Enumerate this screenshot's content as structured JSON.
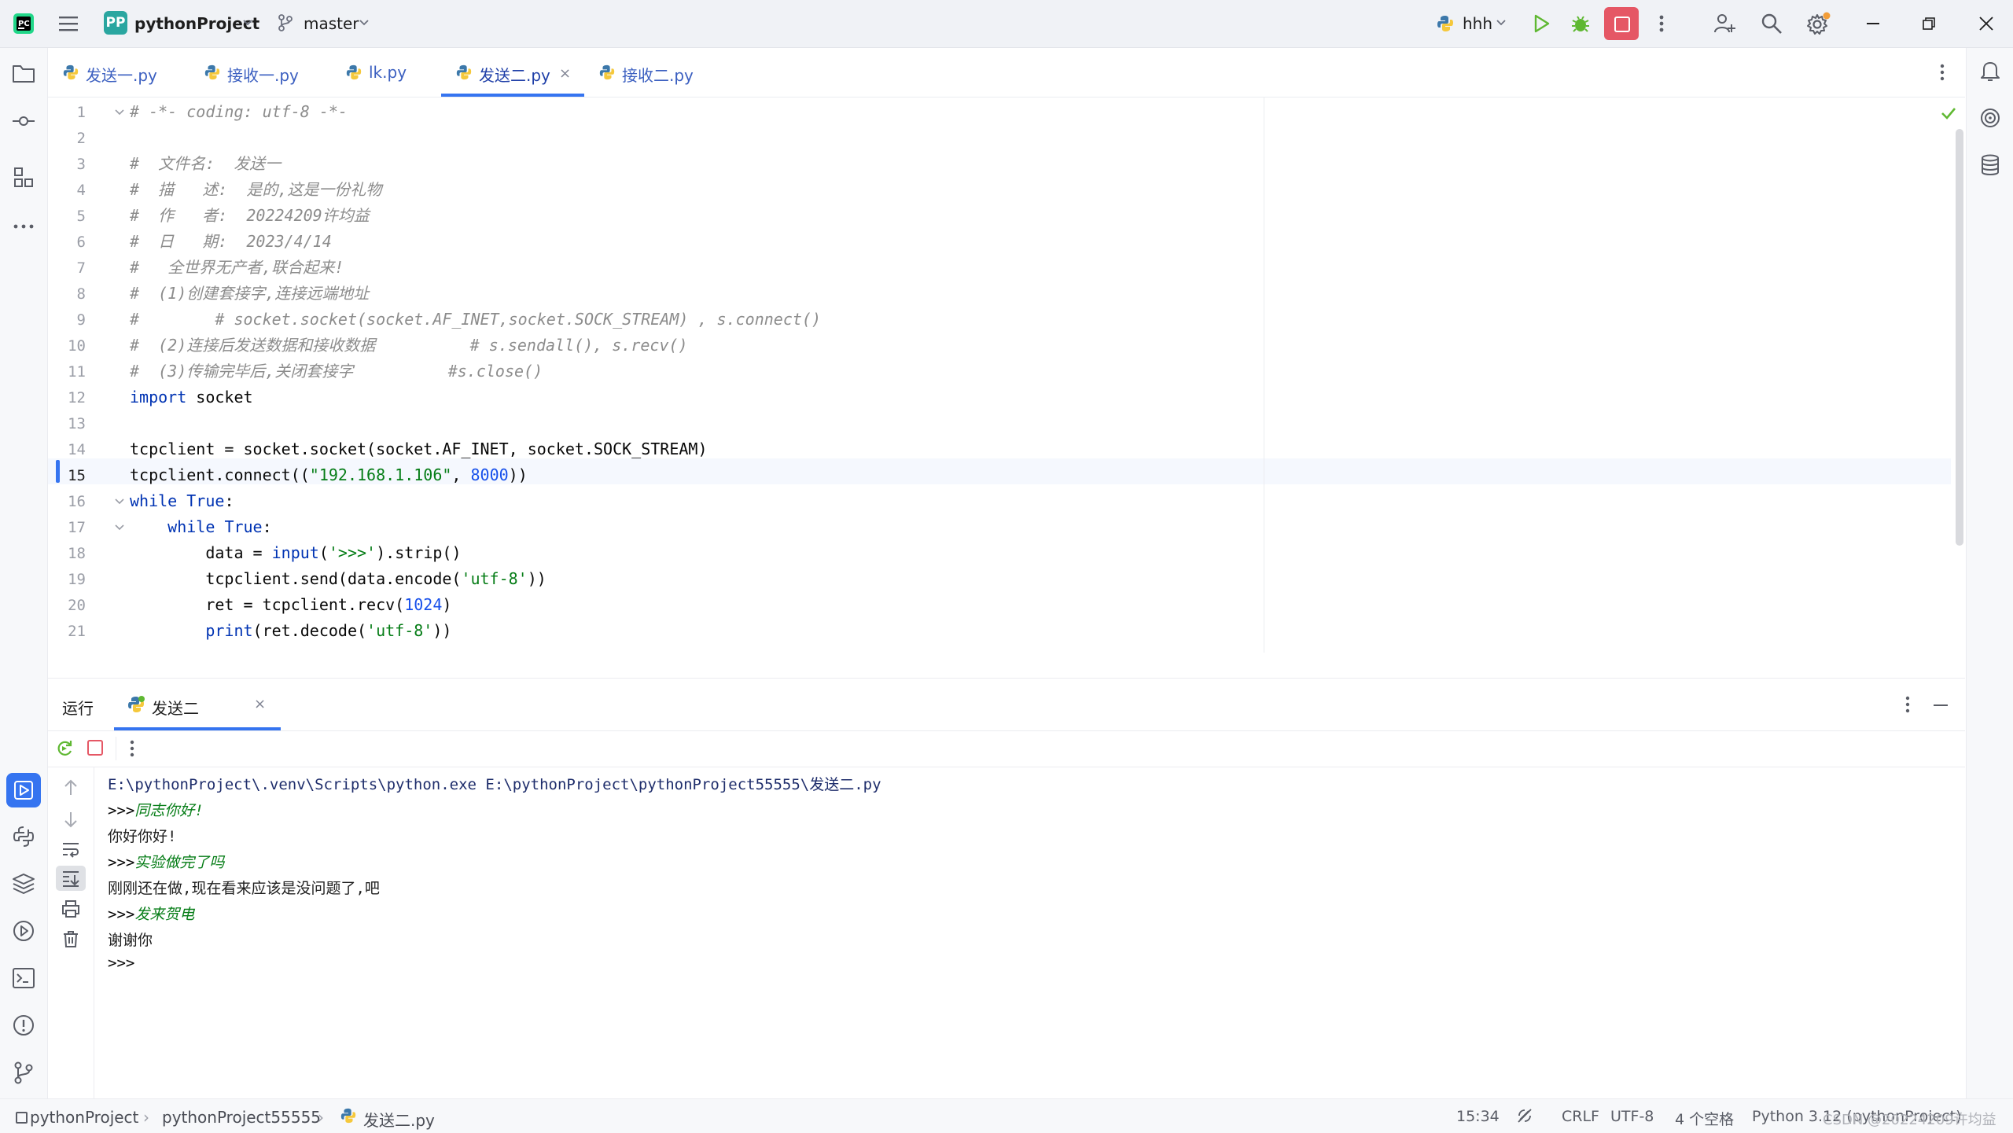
{
  "titlebar": {
    "project_badge": "PP",
    "project_name": "pythonProject",
    "branch": "master",
    "run_config": "hhh"
  },
  "tabs": [
    {
      "label": "发送一.py",
      "active": false
    },
    {
      "label": "接收一.py",
      "active": false
    },
    {
      "label": "lk.py",
      "active": false
    },
    {
      "label": "发送二.py",
      "active": true
    },
    {
      "label": "接收二.py",
      "active": false
    }
  ],
  "tab_close_glyph": "×",
  "editor": {
    "current_line": 15,
    "lines": [
      {
        "n": "1",
        "text": "# -*- coding: utf-8 -*-"
      },
      {
        "n": "2",
        "text": ""
      },
      {
        "n": "3",
        "text": "#  文件名:  发送一"
      },
      {
        "n": "4",
        "text": "#  描   述:  是的,这是一份礼物"
      },
      {
        "n": "5",
        "text": "#  作   者:  20224209许均益"
      },
      {
        "n": "6",
        "text": "#  日   期:  2023/4/14"
      },
      {
        "n": "7",
        "text": "#   全世界无产者,联合起来!"
      },
      {
        "n": "8",
        "text": "#  (1)创建套接字,连接远端地址"
      },
      {
        "n": "9",
        "text": "#        # socket.socket(socket.AF_INET,socket.SOCK_STREAM) , s.connect()"
      },
      {
        "n": "10",
        "text": "#  (2)连接后发送数据和接收数据          # s.sendall(), s.recv()"
      },
      {
        "n": "11",
        "text": "#  (3)传输完毕后,关闭套接字          #s.close()"
      },
      {
        "n": "12",
        "text": "import socket"
      },
      {
        "n": "13",
        "text": ""
      },
      {
        "n": "14",
        "text": "tcpclient = socket.socket(socket.AF_INET, socket.SOCK_STREAM)"
      },
      {
        "n": "15",
        "text": "tcpclient.connect((\"192.168.1.106\", 8000))"
      },
      {
        "n": "16",
        "text": "while True:"
      },
      {
        "n": "17",
        "text": "    while True:"
      },
      {
        "n": "18",
        "text": "        data = input('>>>').strip()"
      },
      {
        "n": "19",
        "text": "        tcpclient.send(data.encode('utf-8'))"
      },
      {
        "n": "20",
        "text": "        ret = tcpclient.recv(1024)"
      },
      {
        "n": "21",
        "text": "        print(ret.decode('utf-8'))"
      }
    ]
  },
  "run_panel": {
    "title": "运行",
    "tab_label": "发送二",
    "console": [
      {
        "kind": "path",
        "text": "E:\\pythonProject\\.venv\\Scripts\\python.exe E:\\pythonProject\\pythonProject55555\\发送二.py"
      },
      {
        "kind": "input",
        "prompt": ">>>",
        "text": "同志你好!"
      },
      {
        "kind": "output",
        "text": "你好你好!"
      },
      {
        "kind": "input",
        "prompt": ">>>",
        "text": "实验做完了吗"
      },
      {
        "kind": "output",
        "text": "刚刚还在做,现在看来应该是没问题了,吧"
      },
      {
        "kind": "input",
        "prompt": ">>>",
        "text": "发来贺电"
      },
      {
        "kind": "output",
        "text": "谢谢你"
      },
      {
        "kind": "input",
        "prompt": ">>>",
        "text": ""
      }
    ]
  },
  "breadcrumb": [
    "pythonProject",
    "pythonProject55555",
    "发送二.py"
  ],
  "status": {
    "position": "15:34",
    "line_ending": "CRLF",
    "encoding": "UTF-8",
    "indent": "4 个空格",
    "interpreter": "Python 3.12 (pythonProject)"
  },
  "watermark": "CSDN @20224209许均益",
  "colors": {
    "accent": "#3574f0",
    "run_green": "#5fb832",
    "debug_green": "#5fb832",
    "stop_red": "#e55765",
    "badge_teal": "#2aa6a0"
  }
}
